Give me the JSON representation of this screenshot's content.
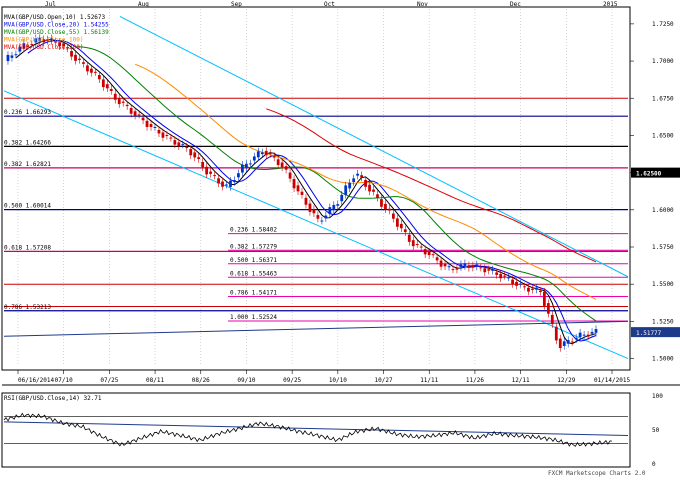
{
  "chart_data": [
    {
      "type": "candlestick",
      "title": "",
      "instrument": "GBP/USD",
      "x_ticks": [
        "06/16/2014",
        "07/10",
        "07/25",
        "08/11",
        "08/26",
        "09/10",
        "09/25",
        "10/10",
        "10/27",
        "11/11",
        "11/26",
        "12/11",
        "12/29",
        "01/14/2015"
      ],
      "month_labels": [
        "Jul",
        "Aug",
        "Sep",
        "Oct",
        "Nov",
        "Dec",
        "2015"
      ],
      "y_ticks": [
        "1.7250",
        "1.7000",
        "1.6750",
        "1.6500",
        "1.6250",
        "1.6000",
        "1.5750",
        "1.5500",
        "1.5250",
        "1.5000"
      ],
      "ylim": [
        1.495,
        1.735
      ],
      "last_price": "1.51777",
      "current_level": "1.62500",
      "close_series_sampled": [
        1.7,
        1.71,
        1.715,
        1.712,
        1.7,
        1.69,
        1.675,
        1.665,
        1.655,
        1.647,
        1.64,
        1.625,
        1.615,
        1.63,
        1.64,
        1.63,
        1.61,
        1.592,
        1.605,
        1.625,
        1.61,
        1.595,
        1.578,
        1.57,
        1.56,
        1.563,
        1.56,
        1.555,
        1.548,
        1.545,
        1.508,
        1.515,
        1.518
      ],
      "moving_averages": [
        {
          "name": "MVA(GBP/USD.Open,10)",
          "value": "1.52673",
          "color": "#000000"
        },
        {
          "name": "MVA(GBP/USD.Close,20)",
          "value": "1.54255",
          "color": "#0000ee"
        },
        {
          "name": "MVA(GBP/USD.Close,55)",
          "value": "1.56139",
          "color": "#008000"
        },
        {
          "name": "MVA(GBP/USD.Close,100)",
          "value": "",
          "color": "#ff8c00"
        },
        {
          "name": "MVA(GBP/USD.Close,200)",
          "value": "",
          "color": "#dd0000"
        }
      ],
      "fib_levels": [
        {
          "label": "0.236 1.66293",
          "value": 1.66293,
          "color": "#00008b"
        },
        {
          "label": "0.382 1.64266",
          "value": 1.64266,
          "color": "#000000"
        },
        {
          "label": "0.382 1.62821",
          "value": 1.62821,
          "color": "#cc0066"
        },
        {
          "label": "0.500 1.60014",
          "value": 1.60014,
          "color": "#00008b"
        },
        {
          "label": "0.618 1.57208",
          "value": 1.57208,
          "color": "#cc0066"
        },
        {
          "label": "0.786 1.53213",
          "value": 1.53213,
          "color": "#00008b"
        }
      ],
      "fib_levels_inner": [
        {
          "label": "0.236 1.58402",
          "value": 1.58402
        },
        {
          "label": "0.382 1.57279",
          "value": 1.57279
        },
        {
          "label": "0.500 1.56371",
          "value": 1.56371
        },
        {
          "label": "0.618 1.55463",
          "value": 1.55463
        },
        {
          "label": "0.786 1.54171",
          "value": 1.54171
        },
        {
          "label": "1.000 1.52524",
          "value": 1.52524
        }
      ],
      "horizontal_levels": [
        1.675,
        1.55,
        1.535
      ]
    },
    {
      "type": "line",
      "title": "RSI(GBP/USD.Close,14) 32.71",
      "y_ticks": [
        "100",
        "50",
        "0"
      ],
      "ylim": [
        0,
        100
      ],
      "values": [
        65,
        72,
        70,
        60,
        55,
        40,
        28,
        38,
        48,
        42,
        35,
        45,
        52,
        60,
        55,
        48,
        42,
        35,
        48,
        52,
        44,
        40,
        42,
        46,
        38,
        45,
        42,
        40,
        36,
        28,
        30,
        32.71
      ]
    }
  ],
  "watermark": "FXCM Marketscope Charts 2.0"
}
